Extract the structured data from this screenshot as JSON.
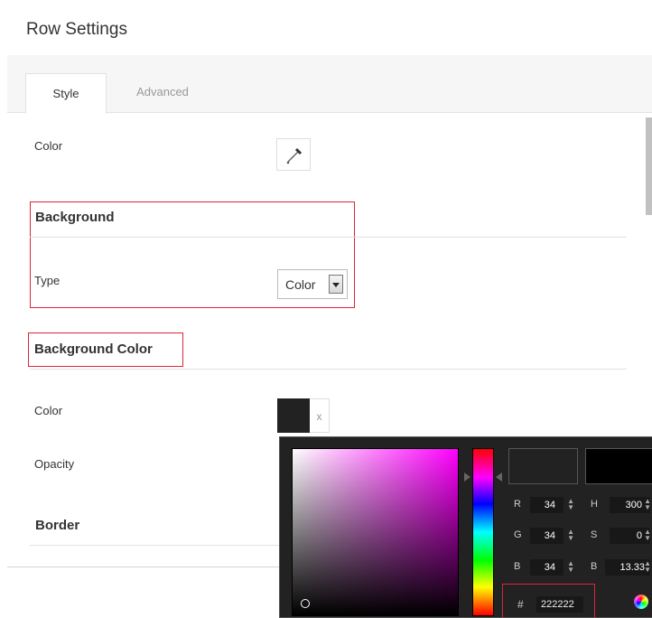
{
  "dialog": {
    "title": "Row Settings"
  },
  "tabs": [
    {
      "label": "Style",
      "active": true
    },
    {
      "label": "Advanced",
      "active": false
    }
  ],
  "fields": {
    "color_label": "Color",
    "background_section": "Background",
    "type_label": "Type",
    "type_value": "Color",
    "bg_color_section": "Background Color",
    "bg_color_label": "Color",
    "bg_color_value": "#222222",
    "clear_label": "x",
    "opacity_label": "Opacity",
    "border_section": "Border"
  },
  "picker_icon": "eyedropper-icon",
  "color_picker": {
    "hue_color": "#ff00ff",
    "new_color": "#222222",
    "current_color": "#000000",
    "r_label": "R",
    "r_value": "34",
    "g_label": "G",
    "g_value": "34",
    "b_label": "B",
    "b_value": "34",
    "h_label": "H",
    "h_value": "300",
    "s_label": "S",
    "s_value": "0",
    "bright_label": "B",
    "bright_value": "13.33",
    "hex_label": "#",
    "hex_value": "222222",
    "mode_icon": "color-wheel-icon"
  },
  "accent_color": "#d9263a"
}
